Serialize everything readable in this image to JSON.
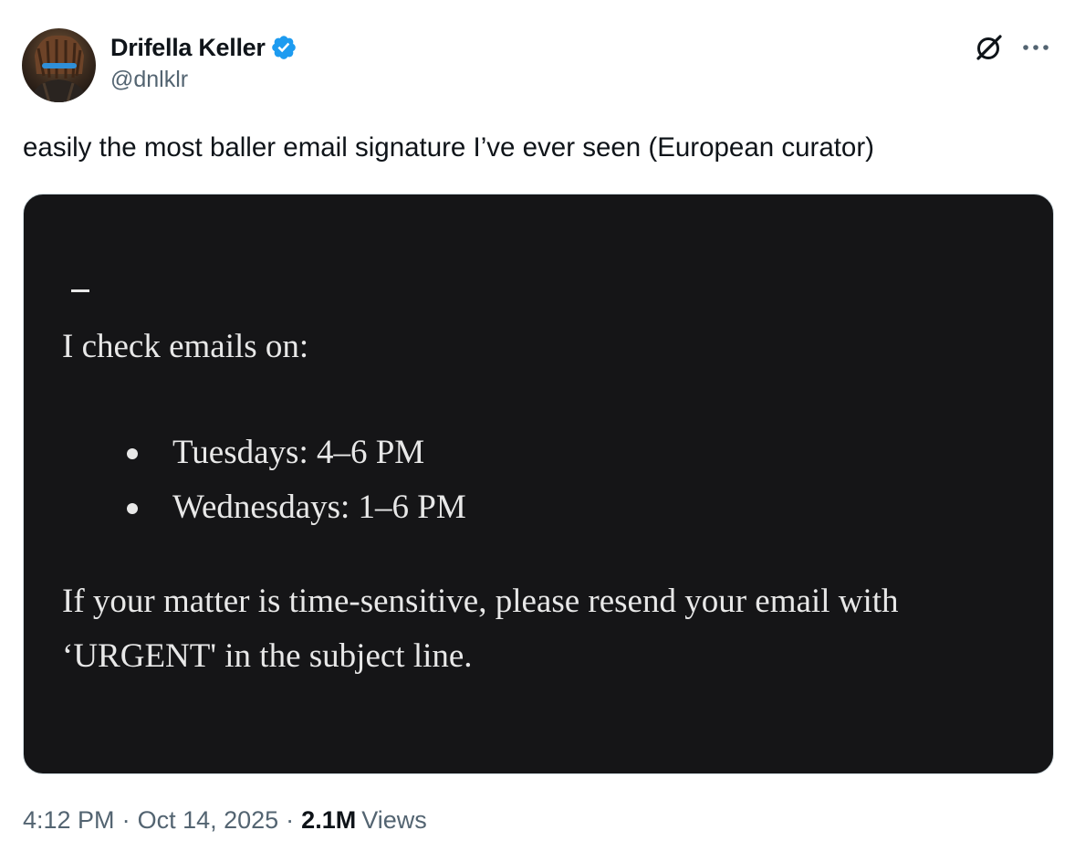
{
  "author": {
    "display_name": "Drifella Keller",
    "handle": "@dnlklr",
    "verified": true,
    "verified_color": "#1d9bf0"
  },
  "tweet": {
    "text": "easily the most baller email signature I’ve ever seen (European curator)"
  },
  "media": {
    "signature": {
      "dash": "—",
      "intro": "I check emails on:",
      "schedule": [
        "Tuesdays: 4–6 PM",
        "Wednesdays: 1–6 PM"
      ],
      "note_line1": "If your matter is time-sensitive, please resend your email with",
      "note_line2": "‘URGENT' in the subject line."
    },
    "background_color": "#151517"
  },
  "meta": {
    "time": "4:12 PM",
    "date": "Oct 14, 2025",
    "views_count": "2.1M",
    "views_label": "Views",
    "separator": "·"
  },
  "icons": {
    "grok": "grok-icon",
    "more": "more-horizontal-icon"
  },
  "colors": {
    "text_primary": "#0f1419",
    "text_secondary": "#536471",
    "border": "#cfd9de"
  }
}
